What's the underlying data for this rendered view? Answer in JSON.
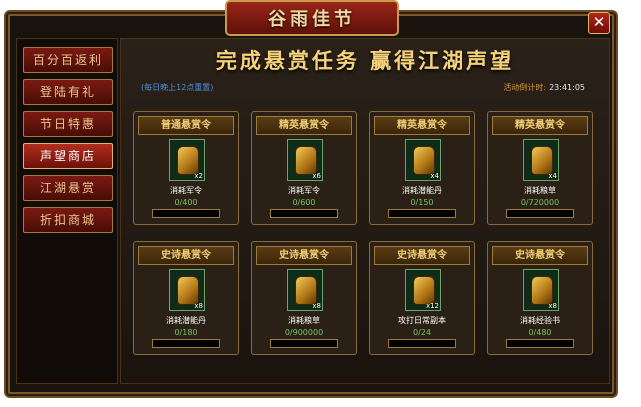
{
  "header": {
    "title": "谷雨佳节"
  },
  "sidebar": {
    "items": [
      {
        "label": "百分百返利"
      },
      {
        "label": "登陆有礼"
      },
      {
        "label": "节日特惠"
      },
      {
        "label": "声望商店",
        "active": true
      },
      {
        "label": "江湖悬赏"
      },
      {
        "label": "折扣商城"
      }
    ]
  },
  "main": {
    "headline": "完成悬赏任务  赢得江湖声望",
    "note": "(每日晚上12点重置)",
    "countdown_label": "活动倒计时:",
    "countdown_value": "23:41:05"
  },
  "cards": [
    {
      "title": "普通悬赏令",
      "qty": "x2",
      "task": "消耗军令",
      "progress": "0/400",
      "ratio": 0
    },
    {
      "title": "精英悬赏令",
      "qty": "x6",
      "task": "消耗军令",
      "progress": "0/600",
      "ratio": 0
    },
    {
      "title": "精英悬赏令",
      "qty": "x4",
      "task": "消耗潜能丹",
      "progress": "0/150",
      "ratio": 0
    },
    {
      "title": "精英悬赏令",
      "qty": "x4",
      "task": "消耗粮草",
      "progress": "0/720000",
      "ratio": 0
    },
    {
      "title": "史诗悬赏令",
      "qty": "x8",
      "task": "消耗潜能丹",
      "progress": "0/180",
      "ratio": 0
    },
    {
      "title": "史诗悬赏令",
      "qty": "x8",
      "task": "消耗粮草",
      "progress": "0/900000",
      "ratio": 0
    },
    {
      "title": "史诗悬赏令",
      "qty": "x12",
      "task": "攻打日常副本",
      "progress": "0/24",
      "ratio": 0
    },
    {
      "title": "史诗悬赏令",
      "qty": "x8",
      "task": "消耗经验书",
      "progress": "0/480",
      "ratio": 0
    }
  ],
  "colors": {
    "accent": "#f6d27a",
    "progress": "#79c65f",
    "note": "#4e8fd6"
  }
}
